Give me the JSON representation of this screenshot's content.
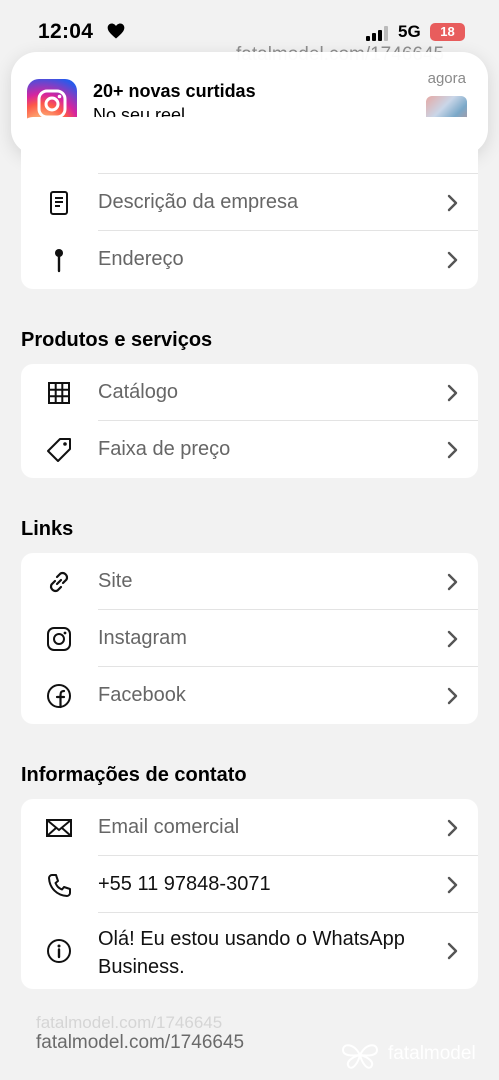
{
  "status_bar": {
    "time": "12:04",
    "network": "5G",
    "battery": "18",
    "watermark": "fatalmodel.com/1746645"
  },
  "notification": {
    "title": "20+ novas curtidas",
    "body": "No seu reel",
    "time": "agora"
  },
  "card1": {
    "items": [
      {
        "label": "Descrição da empresa",
        "icon": "document-icon"
      },
      {
        "label": "Endereço",
        "icon": "pin-icon"
      }
    ]
  },
  "products": {
    "title": "Produtos e serviços",
    "items": [
      {
        "label": "Catálogo",
        "icon": "grid-icon"
      },
      {
        "label": "Faixa de preço",
        "icon": "tag-icon"
      }
    ]
  },
  "links": {
    "title": "Links",
    "items": [
      {
        "label": "Site",
        "icon": "link-icon"
      },
      {
        "label": "Instagram",
        "icon": "instagram-icon"
      },
      {
        "label": "Facebook",
        "icon": "facebook-icon"
      }
    ]
  },
  "contact": {
    "title": "Informações de contato",
    "items": [
      {
        "label": "Email comercial",
        "icon": "envelope-icon"
      },
      {
        "label": "+55 11 97848-3071",
        "icon": "phone-icon"
      },
      {
        "label": "Olá! Eu estou usando o WhatsApp Business.",
        "icon": "info-icon"
      }
    ]
  },
  "footer": {
    "watermark": "fatalmodel.com/1746645",
    "watermark_faint": "fatalmodel.com/1746645",
    "brand": "fatalmodel"
  }
}
